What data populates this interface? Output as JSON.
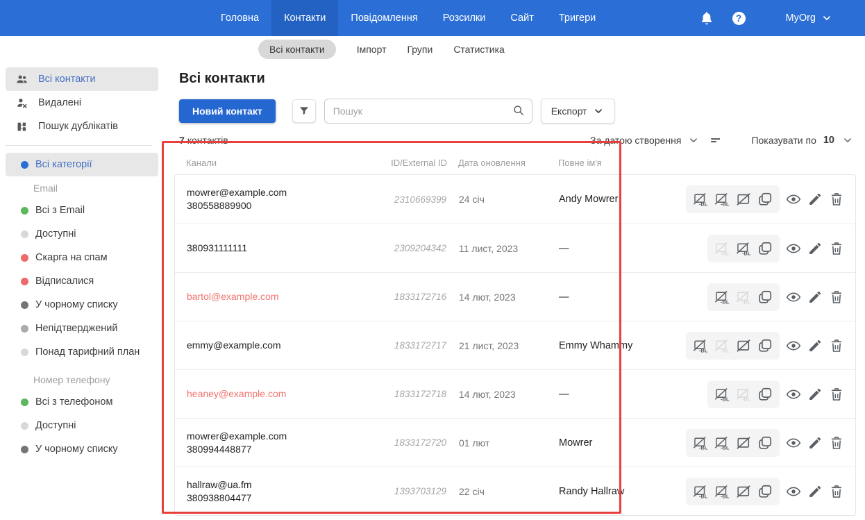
{
  "topnav": {
    "items": [
      {
        "label": "Головна",
        "active": false
      },
      {
        "label": "Контакти",
        "active": true
      },
      {
        "label": "Повідомлення",
        "active": false
      },
      {
        "label": "Розсилки",
        "active": false
      },
      {
        "label": "Сайт",
        "active": false
      },
      {
        "label": "Тригери",
        "active": false
      }
    ],
    "help_glyph": "?",
    "org_name": "MyOrg"
  },
  "subnav": {
    "items": [
      {
        "label": "Всі контакти",
        "active": true
      },
      {
        "label": "Імпорт",
        "active": false
      },
      {
        "label": "Групи",
        "active": false
      },
      {
        "label": "Статистика",
        "active": false
      }
    ]
  },
  "sidebar": {
    "nav": [
      {
        "label": "Всі контакти",
        "icon": "contacts-group-icon",
        "selected": true
      },
      {
        "label": "Видалені",
        "icon": "person-remove-icon",
        "selected": false
      },
      {
        "label": "Пошук дублікатів",
        "icon": "duplicates-icon",
        "selected": false
      }
    ],
    "all_categories": {
      "label": "Всі категорії",
      "dot": "#2b6fd6",
      "selected": true
    },
    "email_group": {
      "label": "Email",
      "items": [
        {
          "label": "Всі з Email",
          "dot": "#5cb85c"
        },
        {
          "label": "Доступні",
          "dot": "#d8d8d8"
        },
        {
          "label": "Скарга на спам",
          "dot": "#ee6a6a"
        },
        {
          "label": "Відписалися",
          "dot": "#ee6a6a"
        },
        {
          "label": "У чорному списку",
          "dot": "#757575"
        },
        {
          "label": "Непідтверджений",
          "dot": "#ababab"
        },
        {
          "label": "Понад тарифний план",
          "dot": "#d8d8d8"
        }
      ]
    },
    "phone_group": {
      "label": "Номер телефону",
      "items": [
        {
          "label": "Всі з телефоном",
          "dot": "#5cb85c"
        },
        {
          "label": "Доступні",
          "dot": "#d8d8d8"
        },
        {
          "label": "У чорному списку",
          "dot": "#757575"
        }
      ]
    }
  },
  "main": {
    "title": "Всі контакти",
    "toolbar": {
      "new_contact": "Новий контакт",
      "search_placeholder": "Пошук",
      "export": "Експорт"
    },
    "summary": {
      "count": "7",
      "count_label": "контактів"
    },
    "sorting": {
      "sort_by": "За датою створення",
      "show_label": "Показувати по",
      "per_page": "10"
    },
    "table": {
      "columns": [
        "Канали",
        "ID/External ID",
        "Дата оновлення",
        "Повне ім'я"
      ],
      "rows": [
        {
          "channels": [
            "mowrer@example.com",
            "380558889900"
          ],
          "id": "2310669399",
          "updated": "24 січ",
          "name": "Andy Mowrer",
          "actions": [
            "email-blacklist",
            "phone-blacklist",
            "unsubscribe",
            "copy"
          ]
        },
        {
          "channels": [
            "380931111111"
          ],
          "id": "2309204342",
          "updated": "11 лист, 2023",
          "name": "—",
          "actions": [
            "email-blacklist:disabled",
            "phone-blacklist",
            "copy"
          ]
        },
        {
          "channels": [
            "bartol@example.com"
          ],
          "channel_status": "unsubscribed",
          "id": "1833172716",
          "updated": "14 лют, 2023",
          "name": "—",
          "actions": [
            "email-blacklist",
            "phone-blacklist:disabled",
            "copy"
          ]
        },
        {
          "channels": [
            "emmy@example.com"
          ],
          "id": "1833172717",
          "updated": "21 лист, 2023",
          "name": "Emmy Whammy",
          "actions": [
            "email-blacklist",
            "phone-blacklist:disabled",
            "unsubscribe",
            "copy"
          ]
        },
        {
          "channels": [
            "heaney@example.com"
          ],
          "channel_status": "unsubscribed",
          "id": "1833172718",
          "updated": "14 лют, 2023",
          "name": "—",
          "actions": [
            "email-blacklist",
            "phone-blacklist:disabled",
            "copy"
          ]
        },
        {
          "channels": [
            "mowrer@example.com",
            "380994448877"
          ],
          "id": "1833172720",
          "updated": "01 лют",
          "name": "Mowrer",
          "actions": [
            "email-blacklist",
            "phone-blacklist",
            "unsubscribe",
            "copy"
          ]
        },
        {
          "channels": [
            "hallraw@ua.fm",
            "380938804477"
          ],
          "id": "1393703129",
          "updated": "22 січ",
          "name": "Randy Hallraw",
          "actions": [
            "email-blacklist",
            "phone-blacklist",
            "unsubscribe",
            "copy"
          ]
        }
      ]
    }
  },
  "colors": {
    "topbar": "#2b6fd6",
    "topbar_active": "#2361c2",
    "primary_button": "#2467d1",
    "selected_item_bg": "#e7e7e7",
    "selected_item_text": "#4470c4",
    "unsubscribed_text": "#f0736e",
    "highlight_border": "#e8403a"
  }
}
